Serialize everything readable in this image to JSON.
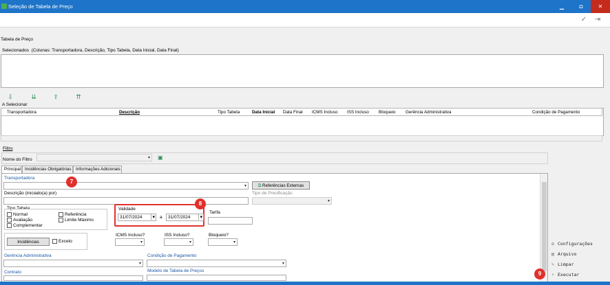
{
  "window": {
    "title": "Seleção de Tabela de Preço",
    "minimize": "▁",
    "maximize": "◘",
    "close": "✕"
  },
  "toolbar": {
    "confirm_icon": "✓",
    "exit_icon": "⇥"
  },
  "header_label": "Tabela de Preço",
  "selected": {
    "label": "Selecionados",
    "columns_hint": "(Colunas: Transportadora, Descrição, Tipo Tabela, Data Inicial, Data Final)"
  },
  "move_buttons": [
    "⇩",
    "⇊",
    "⇧",
    "⇈"
  ],
  "to_select": {
    "label": "A Selecionar",
    "columns": [
      "Transportadora",
      "Descrição",
      "Tipo Tabela",
      "Data Inicial",
      "Data Final",
      "ICMS Incluso",
      "ISS Incluso",
      "Bloqueio",
      "Gerência Administrativa",
      "Condição de Pagamento"
    ]
  },
  "filter": {
    "section_label": "Filtro",
    "name_label": "Nome do Filtro",
    "name_value": ""
  },
  "tabs": [
    "Principal",
    "Incidências Obrigatórias",
    "Informações Adicionais"
  ],
  "form": {
    "transportadora_label": "Transportadora",
    "ref_externas_label": "Referências Externas",
    "descricao_label": "Descrição (iniciado(a) por)",
    "tipo_precificacao_label": "Tipo de Precificação",
    "tipo_tabela_label": "Tipo Tabela",
    "tipo_tabela_options": [
      "Normal",
      "Avaliação",
      "Complementar",
      "Referência",
      "Limite Máximo"
    ],
    "validade_label": "Validade",
    "date_from": "31/07/2024",
    "date_sep": "a",
    "date_to": "31/07/2024",
    "tarifa_label": "Tarifa",
    "incidencias_button": "Incidências",
    "exceto_label": "Exceto",
    "icms_label": "ICMS Incluso?",
    "iss_label": "ISS Incluso?",
    "bloqueio_label": "Bloqueio?",
    "gerencia_label": "Gerência Administrativa",
    "condicao_label": "Condição de Pagamento",
    "contrato_label": "Contrato",
    "modelo_label": "Modelo de Tabela de Preços"
  },
  "side_actions": [
    "Configurações",
    "Arquivo",
    "Limpar",
    "Executar"
  ],
  "markers": [
    "7",
    "8",
    "9"
  ],
  "colors": {
    "titlebar": "#1e74c8",
    "marker": "#e0312c",
    "label_blue": "#1a57a6"
  }
}
